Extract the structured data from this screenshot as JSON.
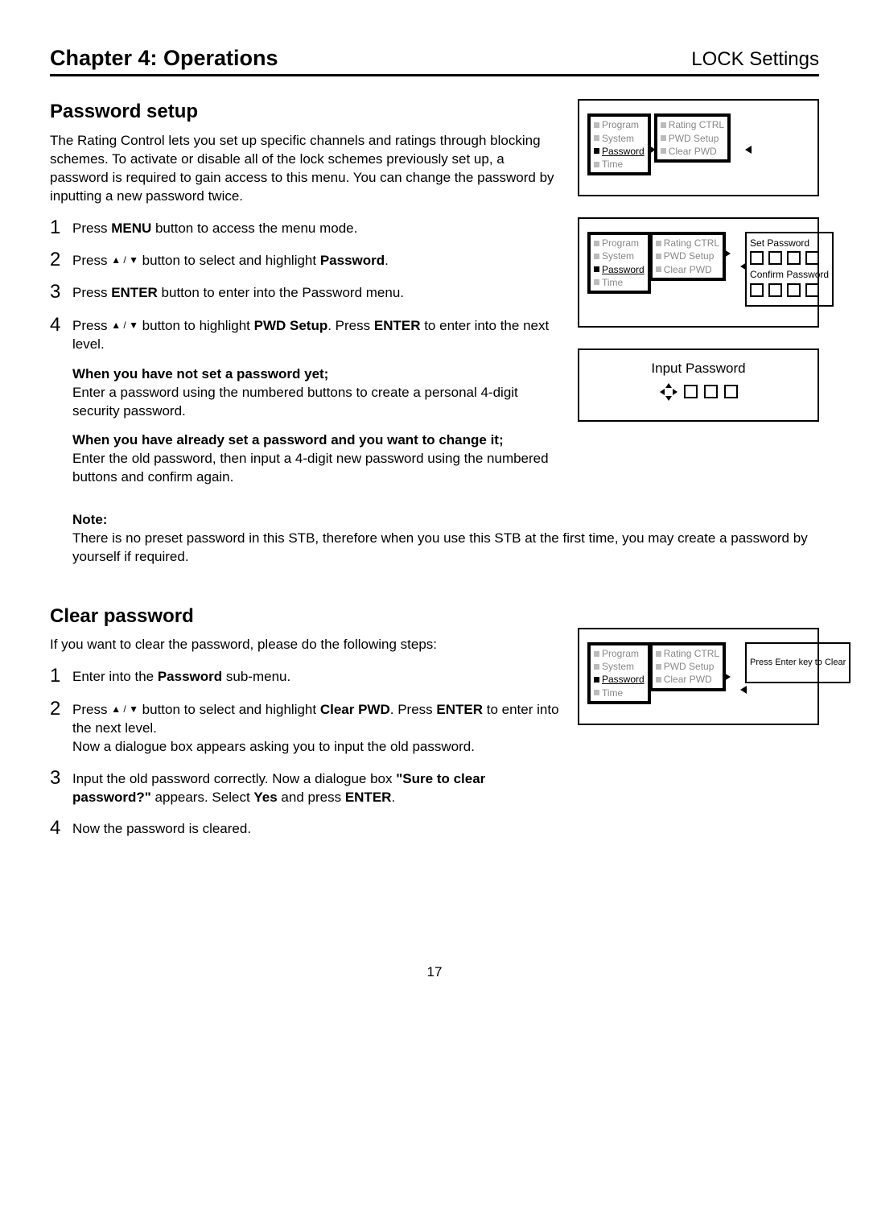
{
  "header": {
    "chapter": "Chapter 4: Operations",
    "section": "LOCK Settings"
  },
  "pwdSetup": {
    "title": "Password setup",
    "desc": "The Rating Control lets you set up specific channels and ratings through blocking schemes. To activate or disable all of the lock schemes previously set up, a password is required to gain access to this menu. You can change the password by inputting a new password twice.",
    "steps": {
      "s1a": "Press ",
      "s1b": "MENU",
      "s1c": " button to access the menu mode.",
      "s2a": "Press ",
      "s2b": " button to select and highlight ",
      "s2c": "Password",
      "s2d": ".",
      "s3a": "Press ",
      "s3b": "ENTER",
      "s3c": " button to enter into the Password menu.",
      "s4a": "Press ",
      "s4b": " button to highlight ",
      "s4c": "PWD Setup",
      "s4d": ". Press ",
      "s4e": "ENTER",
      "s4f": " to enter into the next level."
    },
    "sub1": {
      "head": "When you have not set a password yet;",
      "body": "Enter a password using the numbered buttons to create a personal 4-digit security password."
    },
    "sub2": {
      "head": "When you have already set a password and you want to change it;",
      "body": "Enter the old password, then input a 4-digit new password using the numbered buttons and confirm again."
    },
    "note": {
      "head": "Note:",
      "body": "There is no preset password in this STB, therefore when you use this STB at the first time, you may create a password by yourself if required."
    }
  },
  "clearPwd": {
    "title": "Clear password",
    "desc": "If you want to clear the password, please do the following steps:",
    "steps": {
      "s1a": "Enter into the ",
      "s1b": "Password",
      "s1c": " sub-menu.",
      "s2a": "Press ",
      "s2b": " button to select and highlight ",
      "s2c": "Clear PWD",
      "s2d": ". Press ",
      "s2e": "ENTER",
      "s2f": " to enter into the next level.",
      "s2g": "Now a dialogue box appears asking you to input the old password.",
      "s3a": "Input the old password correctly. Now a dialogue box ",
      "s3b": "\"Sure to clear password?\"",
      "s3c": " appears. Select ",
      "s3d": "Yes",
      "s3e": " and press ",
      "s3f": "ENTER",
      "s3g": ".",
      "s4": "Now the password is cleared."
    }
  },
  "figures": {
    "menu1": {
      "left": [
        "Program",
        "System",
        "Password",
        "Time"
      ],
      "right": [
        "Rating CTRL",
        "PWD Setup",
        "Clear PWD"
      ]
    },
    "menu2": {
      "left": [
        "Program",
        "System",
        "Password",
        "Time"
      ],
      "right": [
        "Rating CTRL",
        "PWD Setup",
        "Clear PWD"
      ],
      "setPwd": "Set Password",
      "confirmPwd": "Confirm Password"
    },
    "inputPwd": "Input Password",
    "menuClear": {
      "left": [
        "Program",
        "System",
        "Password",
        "Time"
      ],
      "right": [
        "Rating CTRL",
        "PWD Setup",
        "Clear PWD"
      ],
      "prompt": "Press Enter key to Clear"
    }
  },
  "pageNum": "17"
}
